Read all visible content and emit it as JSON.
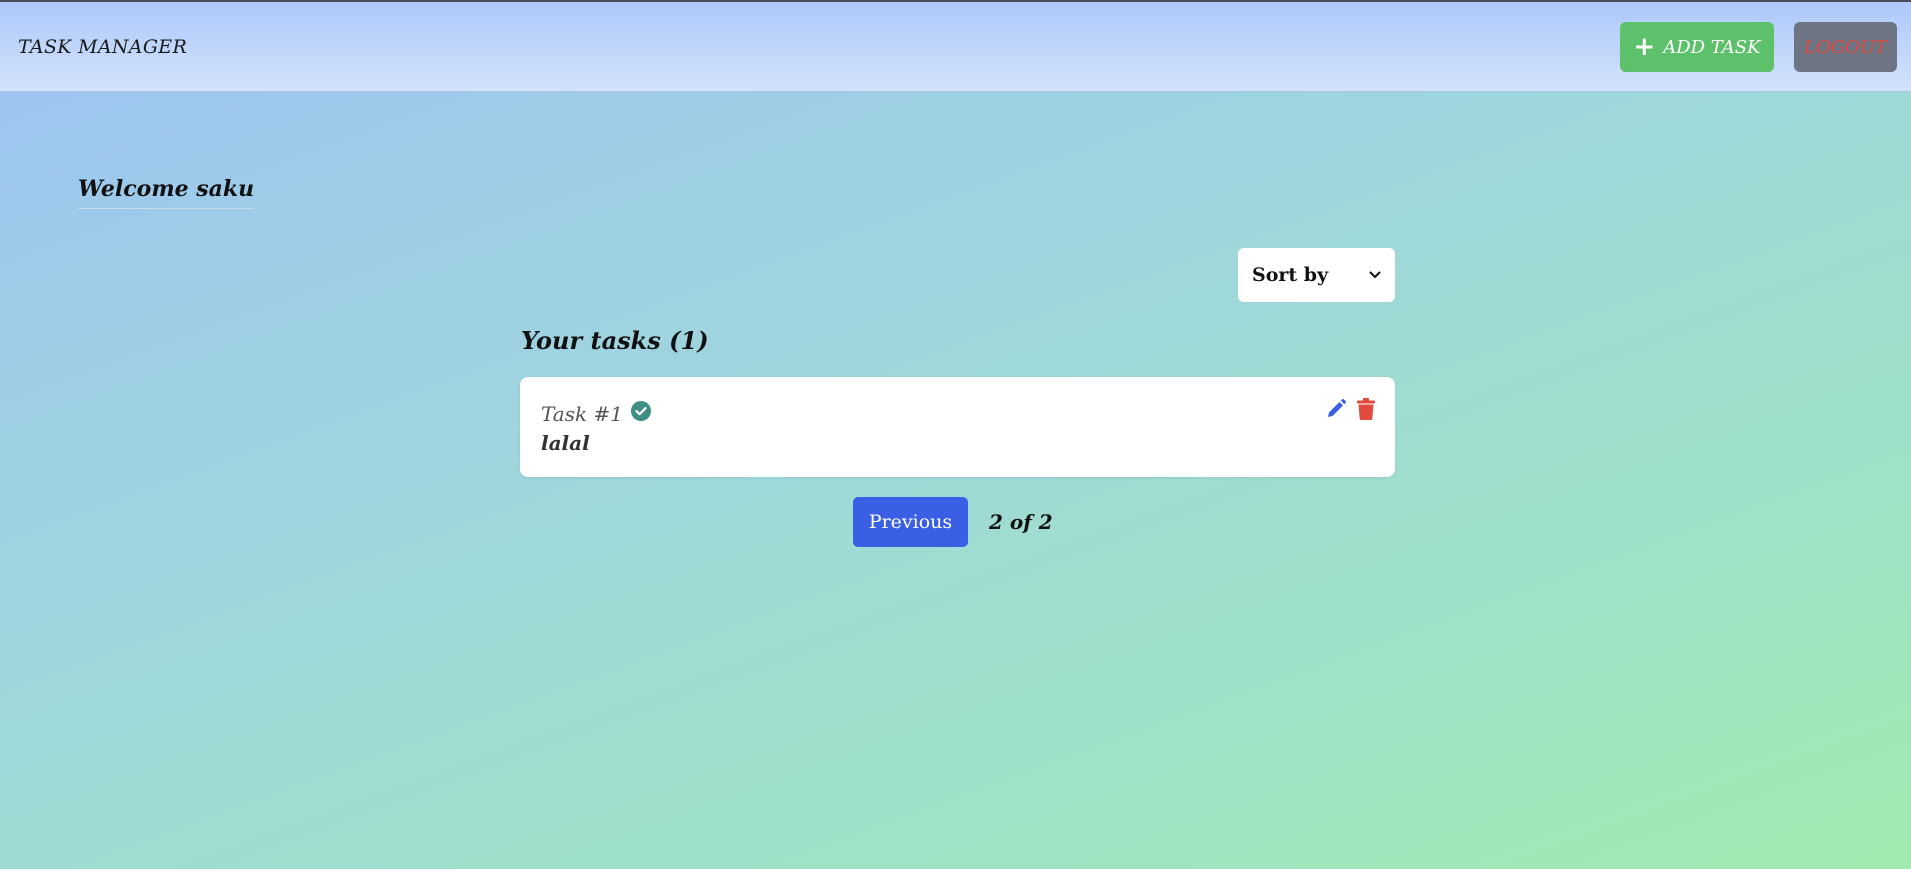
{
  "navbar": {
    "brand": "TASK MANAGER",
    "add_task_label": "ADD TASK",
    "logout_label": "LOGOUT"
  },
  "welcome": "Welcome saku",
  "sort": {
    "selected": "Sort by"
  },
  "tasks_heading": "Your tasks (1)",
  "tasks": [
    {
      "title": "Task #1",
      "description": "lalal",
      "completed": true
    }
  ],
  "pagination": {
    "previous_label": "Previous",
    "page_info": "2 of 2"
  },
  "colors": {
    "add": "#5cc16a",
    "logout_bg": "#6d7585",
    "logout_text": "#e04a3f",
    "primary": "#3a5fe5",
    "check": "#3d8f83",
    "edit": "#3a5fe5",
    "delete": "#e04a3f"
  },
  "icons": [
    "plus-icon",
    "check-circle-icon",
    "pencil-icon",
    "trash-icon",
    "chevron-down-icon"
  ]
}
